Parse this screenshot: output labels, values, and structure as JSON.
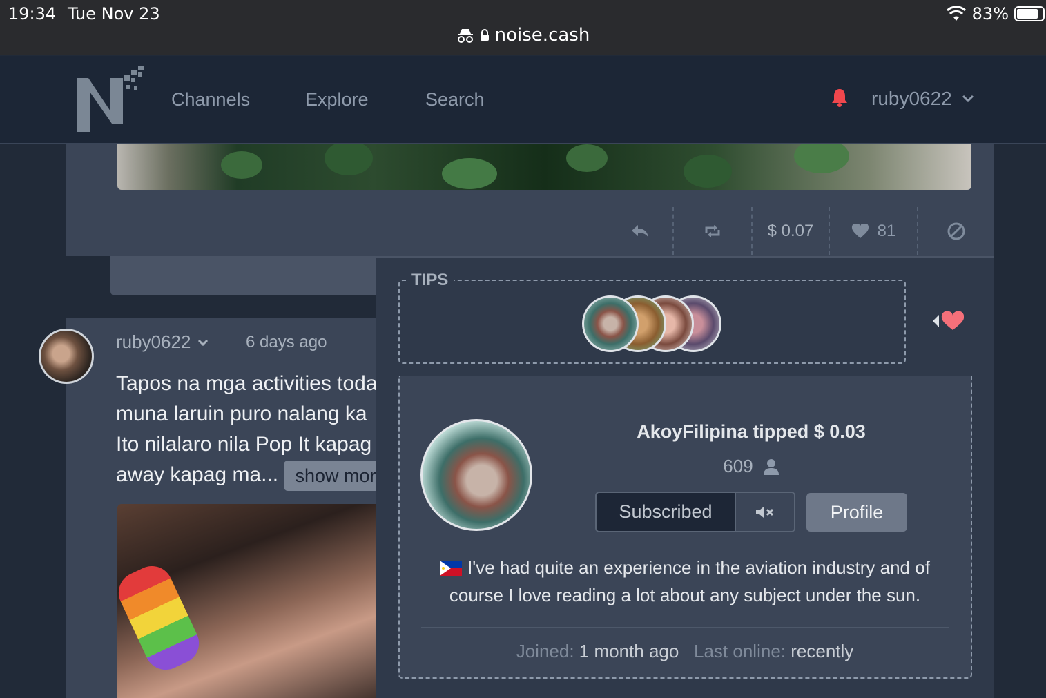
{
  "status_bar": {
    "time": "19:34",
    "date": "Tue Nov 23",
    "battery": "83%",
    "url": "noise.cash"
  },
  "navbar": {
    "links": [
      "Channels",
      "Explore",
      "Search"
    ],
    "username": "ruby0622"
  },
  "top_post": {
    "tip_amount": "$ 0.07",
    "likes": "81"
  },
  "post": {
    "author": "ruby0622",
    "time": "6 days ago",
    "lines": [
      "Tapos na mga activities toda",
      "muna laruin puro nalang ka",
      "Ito nilalaro nila Pop It kapag",
      "away kapag ma..."
    ],
    "show_more": "show more"
  },
  "tips": {
    "label": "TIPS",
    "tipper_count": 4
  },
  "profile_card": {
    "tipped_text": "AkoyFilipina tipped $ 0.03",
    "followers": "609",
    "subscribed_label": "Subscribed",
    "profile_label": "Profile",
    "bio": "I've had quite an experience in the aviation industry and of course I love reading a lot about any subject under the sun.",
    "joined_label": "Joined:",
    "joined_value": "1 month ago",
    "last_online_label": "Last online:",
    "last_online_value": "recently"
  },
  "colors": {
    "background": "#212a38",
    "card": "#3b4557",
    "navbar": "#1c2636",
    "accent_bell": "#f0474d",
    "heart": "#f5707a",
    "muted_text": "#8e9aab"
  }
}
